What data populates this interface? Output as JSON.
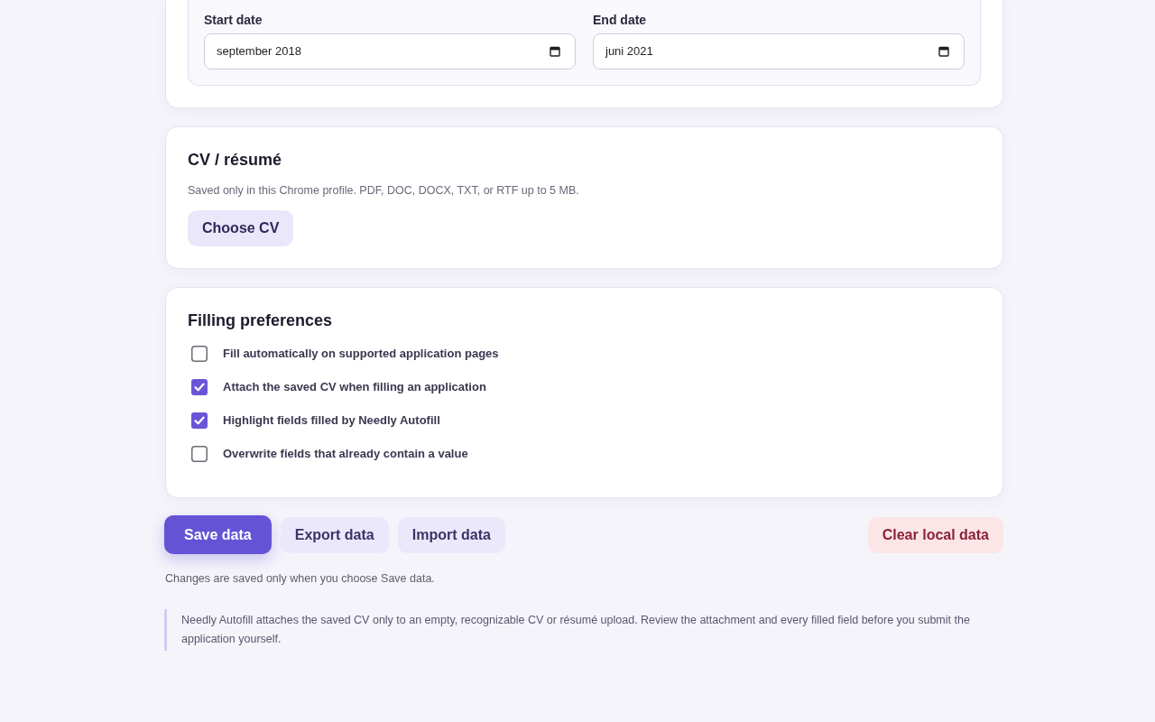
{
  "dates": [
    {
      "label": "Start date",
      "value": "september 2018"
    },
    {
      "label": "End date",
      "value": "juni 2021"
    }
  ],
  "cv_section": {
    "title": "CV / résumé",
    "hint": "Saved only in this Chrome profile. PDF, DOC, DOCX, TXT, or RTF up to 5 MB.",
    "button": "Choose CV"
  },
  "preferences": {
    "title": "Filling preferences",
    "options": [
      {
        "label": "Fill automatically on supported application pages",
        "checked": false
      },
      {
        "label": "Attach the saved CV when filling an application",
        "checked": true
      },
      {
        "label": "Highlight fields filled by Needly Autofill",
        "checked": true
      },
      {
        "label": "Overwrite fields that already contain a value",
        "checked": false
      }
    ]
  },
  "actions": [
    {
      "label": "Save data",
      "kind": "primary"
    },
    {
      "label": "Export data",
      "kind": "secondary"
    },
    {
      "label": "Import data",
      "kind": "secondary"
    },
    {
      "label": "Clear local data",
      "kind": "danger"
    }
  ],
  "save_note": "Changes are saved only when you choose Save data.",
  "notice": "Needly Autofill attaches the saved CV only to an empty, recognizable CV or résumé upload. Review the attachment and every filled field before you submit the application yourself."
}
